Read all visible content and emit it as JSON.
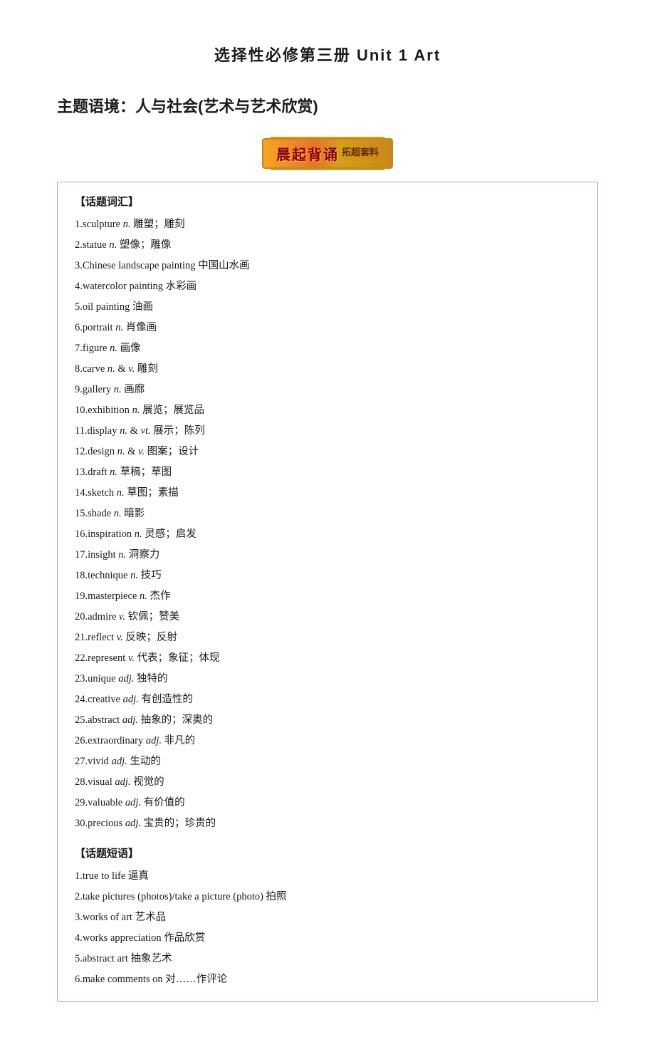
{
  "header": {
    "main_title": "选择性必修第三册    Unit 1    Art"
  },
  "theme": {
    "title": "主题语境：人与社会(艺术与艺术欣赏)"
  },
  "banner": {
    "text": "晨起背诵",
    "subtitle": "拓超套料"
  },
  "vocab_section": {
    "title": "【话题词汇】",
    "items": [
      "1.sculpture n.   雕塑；雕刻",
      "2.statue n.   塑像；雕像",
      "3.Chinese landscape painting   中国山水画",
      "4.watercolor painting   水彩画",
      "5.oil painting   油画",
      "6.portrait n.   肖像画",
      "7.figure n.   画像",
      "8.carve n. & v.   雕刻",
      "9.gallery n.   画廊",
      "10.exhibition n.   展览；展览品",
      "11.display n. & vt.   展示；陈列",
      "12.design n. & v.   图案；设计",
      "13.draft n.   草稿；草图",
      "14.sketch n.   草图；素描",
      "15.shade n.   暗影",
      "16.inspiration n.   灵感；启发",
      "17.insight n.   洞察力",
      "18.technique n.   技巧",
      "19.masterpiece n.   杰作",
      "20.admire v.   钦佩；赞美",
      "21.reflect v.   反映；反射",
      "22.represent v.   代表；象征；体现",
      "23.unique adj.   独特的",
      "24.creative adj.   有创造性的",
      "25.abstract adj.   抽象的；深奥的",
      "26.extraordinary adj.   非凡的",
      "27.vivid adj.   生动的",
      "28.visual adj.   视觉的",
      "29.valuable adj.   有价值的",
      "30.precious adj.   宝贵的；珍贵的"
    ]
  },
  "phrases_section": {
    "title": "【话题短语】",
    "items": [
      "1.true to life   逼真",
      "2.take pictures (photos)/take a picture (photo)   拍照",
      "3.works of art   艺术品",
      "4.works appreciation   作品欣赏",
      "5.abstract art   抽象艺术",
      "6.make comments on   对……作评论"
    ]
  }
}
